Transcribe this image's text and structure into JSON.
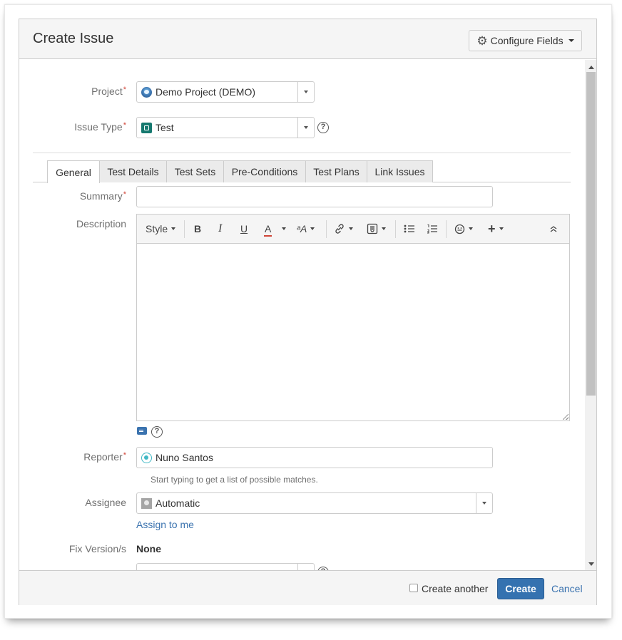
{
  "dialog": {
    "title": "Create Issue",
    "configure_fields_label": "Configure Fields"
  },
  "fields": {
    "project": {
      "label": "Project",
      "required_mark": "*",
      "value": "Demo Project (DEMO)",
      "icon": "project-avatar-icon"
    },
    "issue_type": {
      "label": "Issue Type",
      "required_mark": "*",
      "value": "Test",
      "icon": "test-issue-type-icon"
    },
    "summary": {
      "label": "Summary",
      "required_mark": "*",
      "value": ""
    },
    "description": {
      "label": "Description"
    },
    "reporter": {
      "label": "Reporter",
      "required_mark": "*",
      "value": "Nuno Santos",
      "hint": "Start typing to get a list of possible matches."
    },
    "assignee": {
      "label": "Assignee",
      "value": "Automatic",
      "assign_to_me": "Assign to me"
    },
    "fix_versions": {
      "label": "Fix Version/s",
      "value": "None"
    }
  },
  "tabs": [
    {
      "label": "General",
      "active": true
    },
    {
      "label": "Test Details",
      "active": false
    },
    {
      "label": "Test Sets",
      "active": false
    },
    {
      "label": "Pre-Conditions",
      "active": false
    },
    {
      "label": "Test Plans",
      "active": false
    },
    {
      "label": "Link Issues",
      "active": false
    }
  ],
  "editor_toolbar": {
    "style": "Style",
    "bold": "B",
    "italic": "I",
    "underline": "U",
    "text_color": "A",
    "text_effects": "ᵃA"
  },
  "footer": {
    "create_another_label": "Create another",
    "create_another_checked": false,
    "create_label": "Create",
    "cancel_label": "Cancel"
  },
  "colors": {
    "primary": "#3572b0",
    "link": "#3b73af",
    "required": "#d04437",
    "header_bg": "#f5f5f5"
  }
}
